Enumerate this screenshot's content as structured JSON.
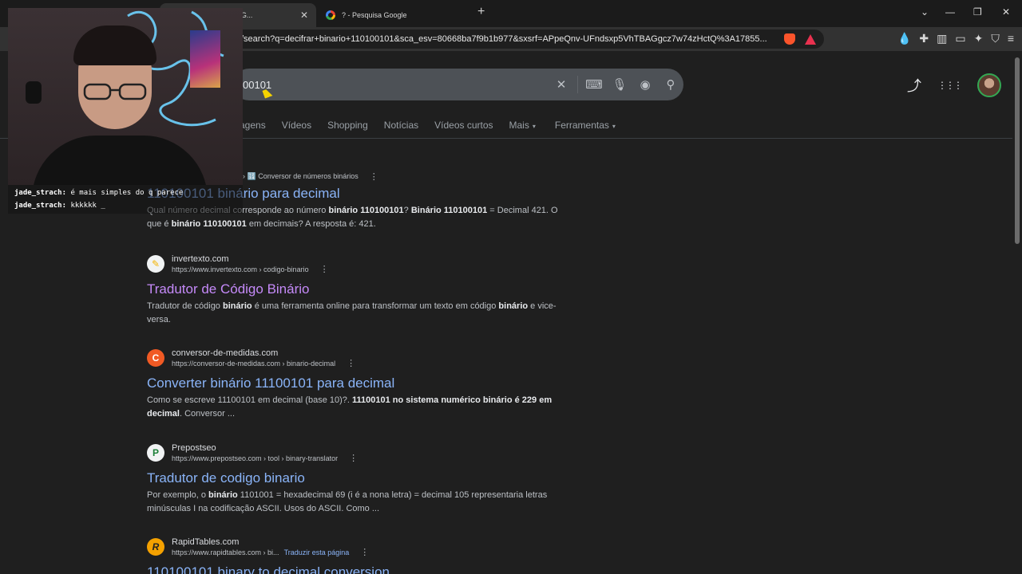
{
  "browser": {
    "tabs": [
      {
        "title": "110100101 - Pesquisa G...",
        "active": true
      },
      {
        "title": "? - Pesquisa Google",
        "active": false
      }
    ],
    "new_tab_symbol": "+",
    "tab_close_symbol": "✕",
    "url": "/search?q=decifrar+binario+110100101&sca_esv=80668ba7f9b1b977&sxsrf=APpeQnv-UFndsxp5VhTBAGgcz7w74zHctQ%3A17855...",
    "window_controls": {
      "dropdown": "⌄",
      "minimize": "—",
      "restore": "❐",
      "close": "✕"
    },
    "extension_icons": [
      "drop-icon",
      "puzzle-icon",
      "sidebar-icon",
      "wallet-icon",
      "sparkle-icon",
      "shield-icon",
      "menu-icon"
    ],
    "accent_colors": {
      "brave": "#fb542b",
      "bat": "#e9314f"
    }
  },
  "search": {
    "query": "00101",
    "icons": {
      "clear": "✕",
      "keyboard": "⌨",
      "mic": "🎙",
      "lens": "◉",
      "search": "⚲"
    }
  },
  "header": {
    "share": "⤴",
    "apps": "⋮⋮⋮"
  },
  "nav": {
    "tabs": [
      "agens",
      "Vídeos",
      "Shopping",
      "Notícias",
      "Vídeos curtos",
      "Mais",
      "Ferramentas"
    ],
    "caret": "▾"
  },
  "results": [
    {
      "site_name": "",
      "breadcrumb": "› 🔢 Conversor de números binários",
      "title": "110100101 binário para decimal",
      "visited": false,
      "snippet_html": "Qual número decimal corresponde ao número <b>binário 110100101</b>? <b>Binário 110100101</b> = Decimal 421. O que é <b>binário 110100101</b> em decimais? A resposta é: 421."
    },
    {
      "site_name": "invertexto.com",
      "url": "https://www.invertexto.com › codigo-binario",
      "title": "Tradutor de Código Binário",
      "visited": true,
      "snippet_html": "Tradutor de código <b>binário</b> é uma ferramenta online para transformar um texto em código <b>binário</b> e vice-versa."
    },
    {
      "site_name": "conversor-de-medidas.com",
      "url": "https://conversor-de-medidas.com › binario-decimal",
      "title": "Converter binário 11100101 para decimal",
      "visited": false,
      "snippet_html": "Como se escreve 11100101 em decimal (base 10)?. <b>11100101 no sistema numérico binário é 229 em decimal</b>. Conversor ..."
    },
    {
      "site_name": "Prepostseo",
      "url": "https://www.prepostseo.com › tool › binary-translator",
      "title": "Tradutor de codigo binario",
      "visited": false,
      "snippet_html": "Por exemplo, o <b>binário</b> 1101001 = hexadecimal 69 (i é a nona letra) = decimal 105 representaria letras minúsculas I na codificação ASCII. Usos do ASCII. Como ..."
    },
    {
      "site_name": "RapidTables.com",
      "url": "https://www.rapidtables.com › bi...",
      "translate": "Traduzir esta página",
      "title": "110100101 binary to decimal conversion",
      "visited": false,
      "snippet_html": ""
    }
  ],
  "kebab": "⋮",
  "chat": [
    {
      "user": "jade_strach:",
      "message": "é mais simples do q parece"
    },
    {
      "user": "jade_strach:",
      "message": "kkkkkk _"
    }
  ]
}
